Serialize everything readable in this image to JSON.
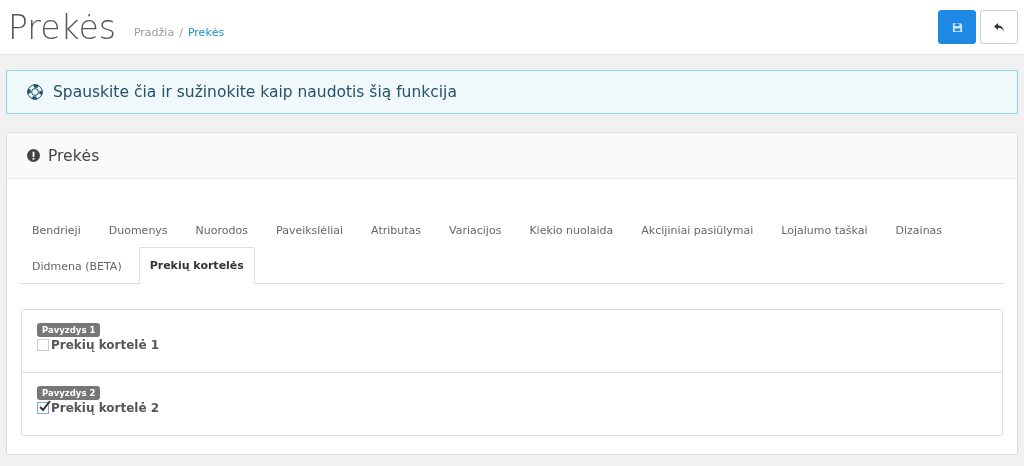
{
  "header": {
    "title": "Prekės",
    "breadcrumb": [
      "Pradžia",
      "Prekės"
    ],
    "breadcrumb_separator": "/"
  },
  "help": {
    "text": "Spauskite čia ir sužinokite kaip naudotis šią funkcija"
  },
  "panel": {
    "title": "Prekės"
  },
  "tabs": [
    {
      "label": "Bendrieji",
      "selected": false
    },
    {
      "label": "Duomenys",
      "selected": false
    },
    {
      "label": "Nuorodos",
      "selected": false
    },
    {
      "label": "Paveikslėliai",
      "selected": false
    },
    {
      "label": "Atributas",
      "selected": false
    },
    {
      "label": "Variacijos",
      "selected": false
    },
    {
      "label": "Kiekio nuolaida",
      "selected": false
    },
    {
      "label": "Akcijiniai pasiūlymai",
      "selected": false
    },
    {
      "label": "Lojalumo taškai",
      "selected": false
    },
    {
      "label": "Dizainas",
      "selected": false
    },
    {
      "label": "Didmena (BETA)",
      "selected": false
    },
    {
      "label": "Prekių kortelės",
      "selected": true
    }
  ],
  "options": [
    {
      "badge": "Pavyzdys 1",
      "label": "Prekių kortelė 1",
      "checked": false
    },
    {
      "badge": "Pavyzdys 2",
      "label": "Prekių kortelė 2",
      "checked": true
    }
  ]
}
